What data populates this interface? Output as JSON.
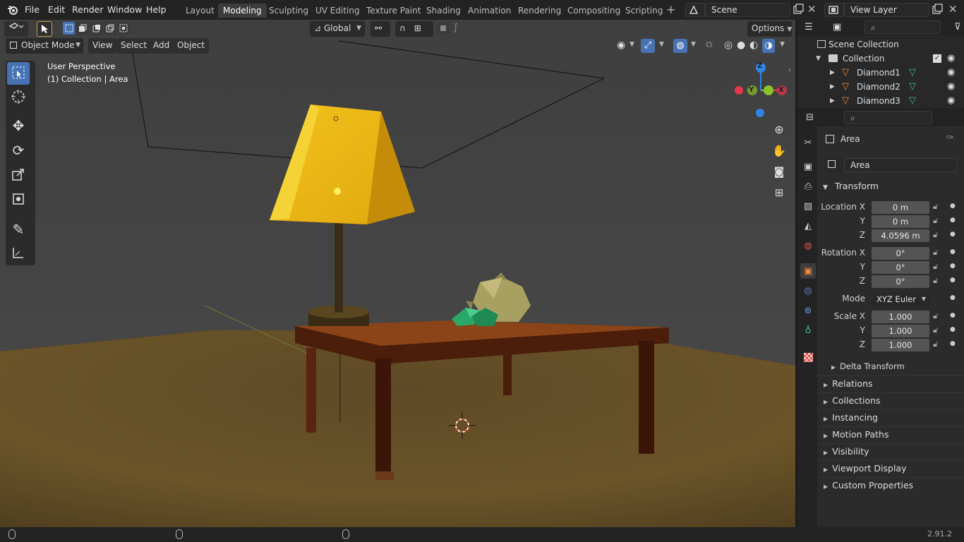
{
  "menu": {
    "file": "File",
    "edit": "Edit",
    "render": "Render",
    "window": "Window",
    "help": "Help"
  },
  "workspaces": [
    "Layout",
    "Modeling",
    "Sculpting",
    "UV Editing",
    "Texture Paint",
    "Shading",
    "Animation",
    "Rendering",
    "Compositing",
    "Scripting"
  ],
  "active_workspace": "Modeling",
  "scene": {
    "name": "Scene",
    "view_layer": "View Layer"
  },
  "viewport": {
    "orientation": "Global",
    "options_label": "Options",
    "mode": "Object Mode",
    "view_menu": "View",
    "select_menu": "Select",
    "add_menu": "Add",
    "object_menu": "Object",
    "perspective_label": "User Perspective",
    "context_label": "(1) Collection | Area",
    "gizmo": {
      "z": "Z",
      "y": "Y",
      "x": "X"
    }
  },
  "outliner": {
    "scene_collection": "Scene Collection",
    "collection": "Collection",
    "objects": [
      "Diamond1",
      "Diamond2",
      "Diamond3"
    ]
  },
  "properties": {
    "object_name": "Area",
    "data_name": "Area",
    "transform_title": "Transform",
    "location": {
      "label": "Location X",
      "x": "0 m",
      "y": "0 m",
      "z": "4.0596 m"
    },
    "rotation": {
      "label": "Rotation X",
      "x": "0°",
      "y": "0°",
      "z": "0°"
    },
    "mode_label": "Mode",
    "mode_value": "XYZ Euler",
    "scale": {
      "label": "Scale X",
      "x": "1.000",
      "y": "1.000",
      "z": "1.000"
    },
    "axis_y": "Y",
    "axis_z": "Z",
    "delta_transform": "Delta Transform",
    "sections": [
      "Relations",
      "Collections",
      "Instancing",
      "Motion Paths",
      "Visibility",
      "Viewport Display",
      "Custom Properties"
    ]
  },
  "status": {
    "version": "2.91.2"
  },
  "colors": {
    "accent": "#4772b3",
    "object_orange": "#f1883c",
    "mesh_green": "#42b986",
    "axis_x": "#e5384d",
    "axis_y": "#8bc32b",
    "axis_z": "#2f83e3"
  }
}
